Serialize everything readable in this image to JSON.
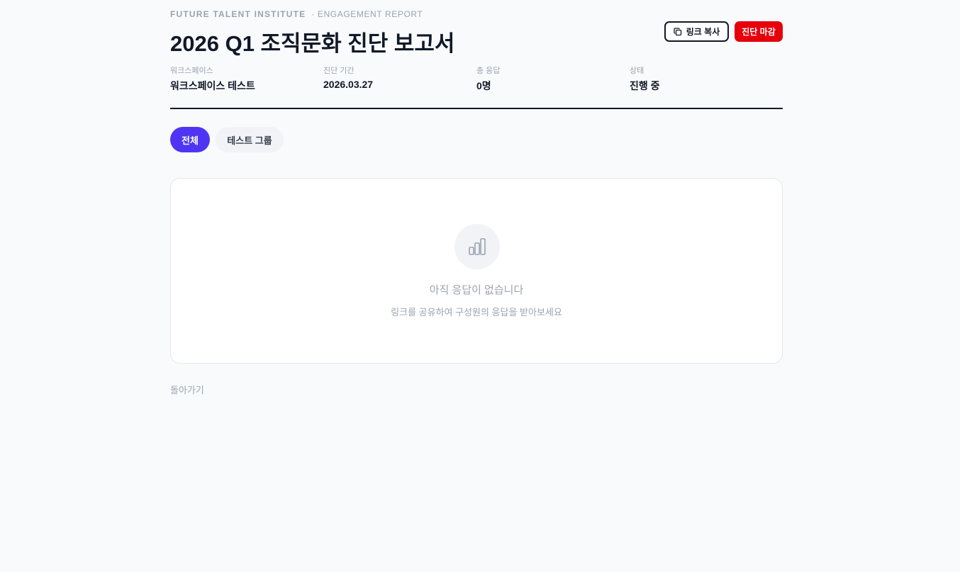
{
  "header": {
    "org": "FUTURE TALENT INSTITUTE",
    "section": "· ENGAGEMENT REPORT",
    "title": "2026 Q1 조직문화 진단 보고서"
  },
  "actions": {
    "copy_link_label": "링크 복사",
    "close_survey_label": "진단 마감"
  },
  "meta": [
    {
      "label": "워크스페이스",
      "value": "워크스페이스 테스트"
    },
    {
      "label": "진단 기간",
      "value": "2026.03.27"
    },
    {
      "label": "총 응답",
      "value": "0명"
    },
    {
      "label": "상태",
      "value": "진행 중"
    }
  ],
  "tabs": [
    {
      "label": "전체",
      "active": true
    },
    {
      "label": "테스트 그룹",
      "active": false
    }
  ],
  "empty_state": {
    "icon": "bar-chart-icon",
    "title": "아직 응답이 없습니다",
    "subtitle": "링크를 공유하여 구성원의 응답을 받아보세요"
  },
  "footer": {
    "back_label": "돌아가기"
  },
  "colors": {
    "accent": "#4f35f3",
    "danger": "#e5000b",
    "text": "#111827",
    "muted": "#9ca3af",
    "background": "#f8fafc"
  }
}
